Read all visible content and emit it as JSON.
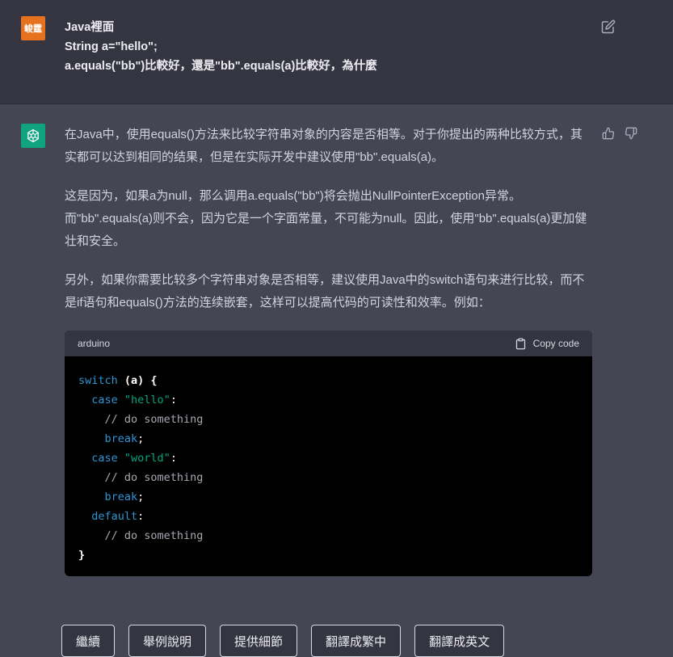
{
  "user": {
    "avatar_text": "峻霆",
    "lines": [
      "Java裡面",
      "String a=\"hello\";",
      "a.equals(\"bb\")比較好，還是\"bb\".equals(a)比較好，為什麼"
    ]
  },
  "assistant": {
    "paragraphs": [
      "在Java中，使用equals()方法来比较字符串对象的内容是否相等。对于你提出的两种比较方式，其实都可以达到相同的结果，但是在实际开发中建议使用\"bb\".equals(a)。",
      "这是因为，如果a为null，那么调用a.equals(\"bb\")将会抛出NullPointerException异常。而\"bb\".equals(a)则不会，因为它是一个字面常量，不可能为null。因此，使用\"bb\".equals(a)更加健壮和安全。",
      "另外，如果你需要比较多个字符串对象是否相等，建议使用Java中的switch语句来进行比较，而不是if语句和equals()方法的连续嵌套，这样可以提高代码的可读性和效率。例如："
    ],
    "code": {
      "language": "arduino",
      "copy_label": "Copy code"
    }
  },
  "suggestions": [
    "繼續",
    "舉例說明",
    "提供細節",
    "翻譯成繁中",
    "翻譯成英文"
  ],
  "colors": {
    "user_bg": "#343541",
    "assistant_bg": "#444654",
    "user_avatar": "#e6711e",
    "assistant_avatar": "#10a37f",
    "code_keyword": "#2e95d3",
    "code_string": "#00a67d"
  }
}
